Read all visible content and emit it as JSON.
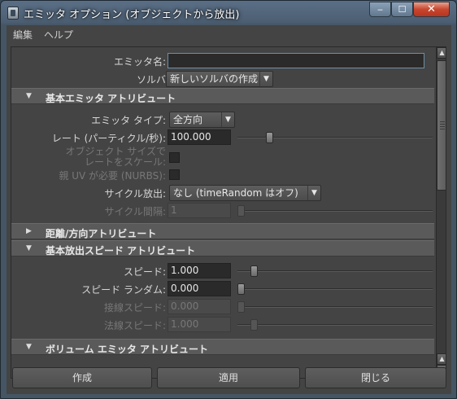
{
  "window": {
    "title": "エミッタ オプション (オブジェクトから放出)"
  },
  "window_controls": {
    "minimize": "‒",
    "maximize": "☐",
    "close": "✕"
  },
  "menubar": {
    "items": [
      "編集",
      "ヘルプ"
    ]
  },
  "top": {
    "emitter_name_label": "エミッタ名:",
    "emitter_name_value": "",
    "solver_label": "ソルバ",
    "solver_value": "新しいソルバの作成"
  },
  "sections": {
    "basic": "基本エミッタ アトリビュート",
    "distance": "距離/方向アトリビュート",
    "speed": "基本放出スピード アトリビュート",
    "volume": "ボリューム エミッタ アトリビュート"
  },
  "basic": {
    "type_label": "エミッタ タイプ:",
    "type_value": "全方向",
    "rate_label": "レート (パーティクル/秒):",
    "rate_value": "100.000",
    "rate_slider": 0.15,
    "scale_rate_label_1": "オブジェクト サイズで",
    "scale_rate_label_2": "レートをスケール:",
    "need_uv_label": "親 UV が必要 (NURBS):",
    "cycle_label": "サイクル放出:",
    "cycle_value": "なし (timeRandom はオフ)",
    "cycle_interval_label": "サイクル間隔:",
    "cycle_interval_value": "1",
    "cycle_interval_slider": 0.0
  },
  "speed": {
    "speed_label": "スピード:",
    "speed_value": "1.000",
    "speed_slider": 0.07,
    "speed_random_label": "スピード ランダム:",
    "speed_random_value": "0.000",
    "speed_random_slider": 0.0,
    "tangent_label": "接線スピード:",
    "tangent_value": "0.000",
    "tangent_slider": 0.0,
    "normal_label": "法線スピード:",
    "normal_value": "1.000",
    "normal_slider": 0.07
  },
  "buttons": {
    "create": "作成",
    "apply": "適用",
    "close": "閉じる"
  }
}
